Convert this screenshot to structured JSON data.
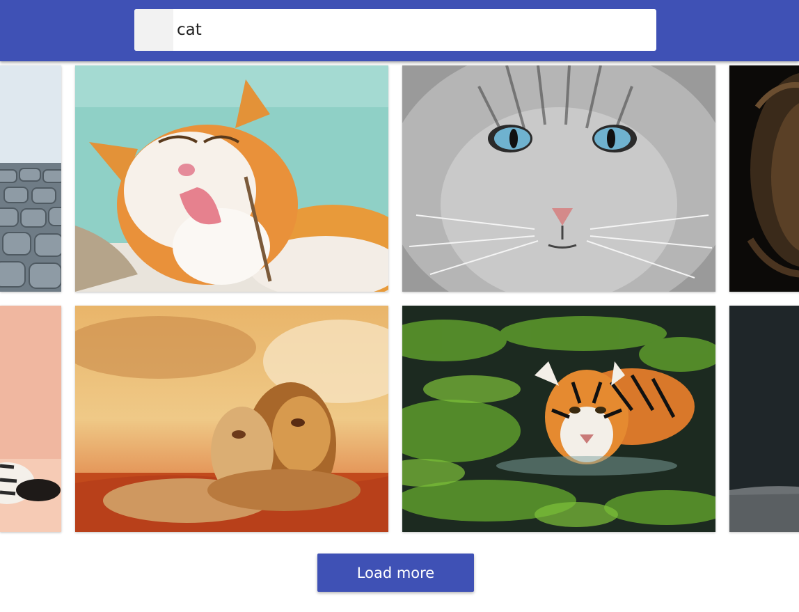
{
  "search": {
    "value": "cat",
    "placeholder": ""
  },
  "gallery": {
    "images": [
      {
        "subject": "cobblestone-street",
        "partial": true
      },
      {
        "subject": "orange-white-cat-licking-paw"
      },
      {
        "subject": "gray-cat-blue-eyes-closeup"
      },
      {
        "subject": "lion-dark-background",
        "partial": true
      },
      {
        "subject": "cat-paw-peach-background",
        "partial": true
      },
      {
        "subject": "lion-and-lioness-sunset"
      },
      {
        "subject": "tiger-swimming-in-water"
      },
      {
        "subject": "dark-animal-photo",
        "partial": true
      }
    ]
  },
  "actions": {
    "load_more_label": "Load more"
  },
  "colors": {
    "primary": "#3f51b5",
    "background": "#ffffff"
  }
}
